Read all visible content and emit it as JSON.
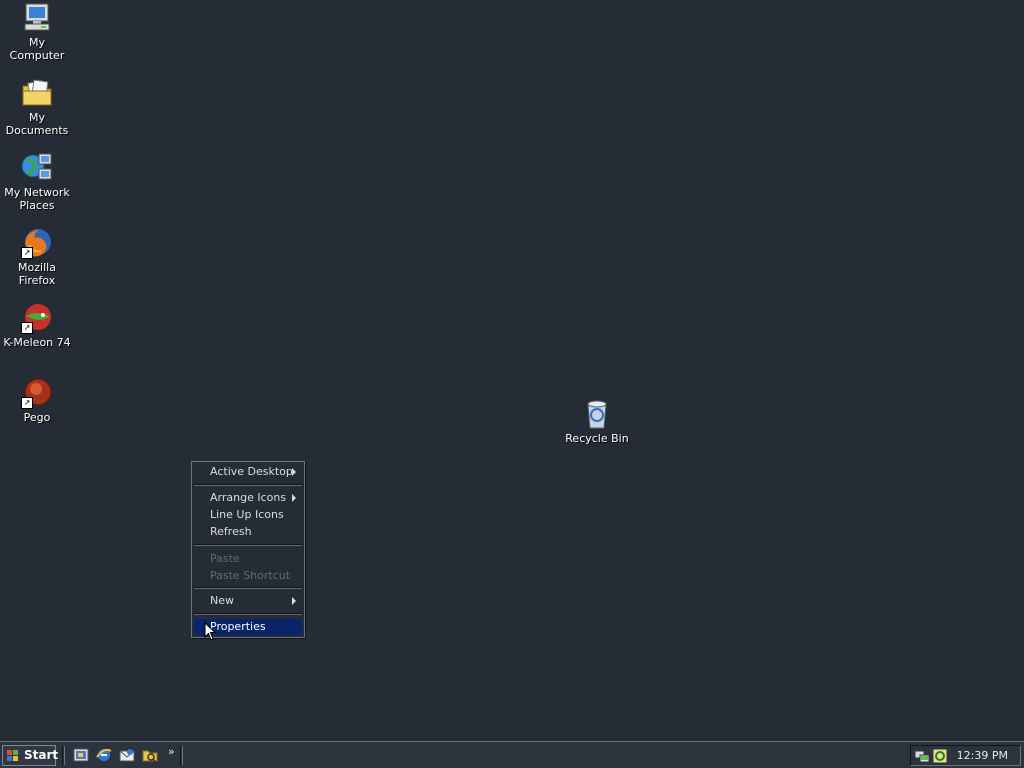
{
  "desktop": {
    "icons": [
      {
        "label_line1": "My Computer",
        "label_line2": ""
      },
      {
        "label_line1": "My Documents",
        "label_line2": ""
      },
      {
        "label_line1": "My Network",
        "label_line2": "Places"
      },
      {
        "label_line1": "Mozilla Firefox",
        "label_line2": ""
      },
      {
        "label_line1": "K-Meleon 74",
        "label_line2": ""
      },
      {
        "label_line1": "Pego",
        "label_line2": ""
      }
    ],
    "recycle_bin": {
      "label": "Recycle Bin"
    }
  },
  "context_menu": {
    "items": [
      {
        "label": "Active Desktop",
        "submenu": true,
        "enabled": true
      },
      {
        "label": "Arrange Icons",
        "submenu": true,
        "enabled": true
      },
      {
        "label": "Line Up Icons",
        "submenu": false,
        "enabled": true
      },
      {
        "label": "Refresh",
        "submenu": false,
        "enabled": true
      },
      {
        "label": "Paste",
        "submenu": false,
        "enabled": false
      },
      {
        "label": "Paste Shortcut",
        "submenu": false,
        "enabled": false
      },
      {
        "label": "New",
        "submenu": true,
        "enabled": true
      },
      {
        "label": "Properties",
        "submenu": false,
        "enabled": true,
        "highlighted": true
      }
    ]
  },
  "taskbar": {
    "start_label": "Start",
    "quick_launch_more": "»",
    "clock": "12:39 PM"
  },
  "colors": {
    "desktop_bg": "#252c35",
    "menu_highlight": "#0a246a"
  }
}
